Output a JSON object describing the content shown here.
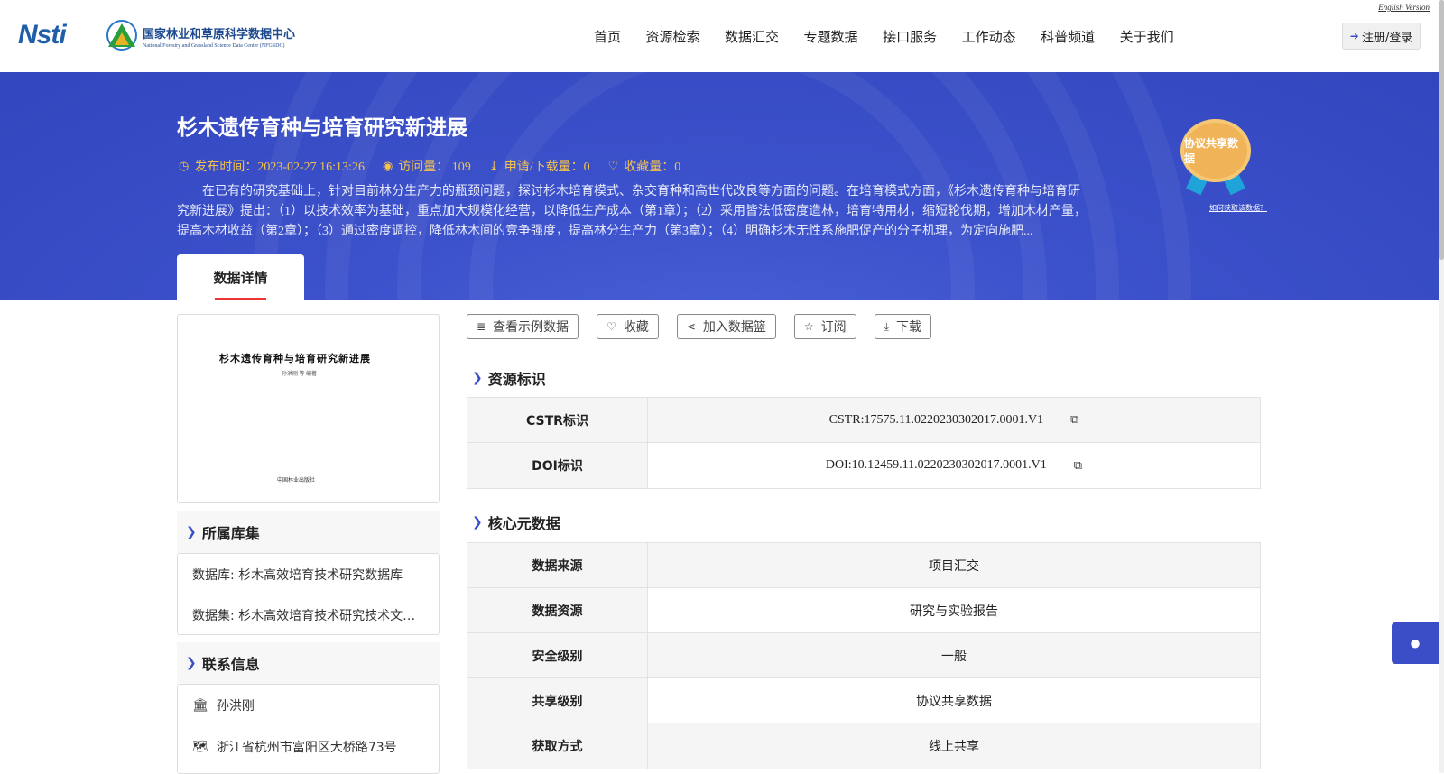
{
  "header": {
    "logo_nsti": "Nsti",
    "logo_cn": "国家林业和草原科学数据中心",
    "logo_en": "National Forestry and Grassland Science Data Center (NFGSDC)",
    "english_version": "English Version",
    "login_label": "注册/登录",
    "nav": [
      "首页",
      "资源检索",
      "数据汇交",
      "专题数据",
      "接口服务",
      "工作动态",
      "科普频道",
      "关于我们"
    ]
  },
  "banner": {
    "title": "杉木遗传育种与培育研究新进展",
    "publish_time": "发布时间：2023-02-27 16:13:26",
    "visits": "访问量： 109",
    "downloads": "申请/下载量：0",
    "favorites": "收藏量：0",
    "description": "在已有的研究基础上，针对目前林分生产力的瓶颈问题，探讨杉木培育模式、杂交育种和高世代改良等方面的问题。在培育模式方面，《杉木遗传育种与培育研究新进展》提出：（1）以技术效率为基础，重点加大规模化经营，以降低生产成本（第1章）；（2）采用皆法低密度造林，培育特用材，缩短轮伐期，增加木材产量，提高木材收益（第2章）；（3）通过密度调控，降低林木间的竞争强度，提高林分生产力（第3章）；（4）明确杉木无性系施肥促产的分子机理，为定向施肥...",
    "badge_text": "协议共享数据",
    "badge_link": "如何获取该数据？",
    "tab_label": "数据详情"
  },
  "cover": {
    "title": "杉木遗传育种与培育研究新进展",
    "authors": "孙洪刚 等 编著",
    "publisher": "中国林业出版社"
  },
  "library": {
    "heading": "所属库集",
    "database": "数据库: 杉木高效培育技术研究数据库",
    "dataset": "数据集: 杉木高效培育技术研究技术文献数据集"
  },
  "contact": {
    "heading": "联系信息",
    "name": "孙洪刚",
    "address": "浙江省杭州市富阳区大桥路73号"
  },
  "actions": {
    "view_sample": "查看示例数据",
    "favorite": "收藏",
    "add_basket": "加入数据篮",
    "subscribe": "订阅",
    "download": "下载"
  },
  "resource_id": {
    "heading": "资源标识",
    "rows": [
      {
        "key": "CSTR标识",
        "value": "CSTR:17575.11.0220230302017.0001.V1"
      },
      {
        "key": "DOI标识",
        "value": "DOI:10.12459.11.0220230302017.0001.V1"
      }
    ]
  },
  "core_meta": {
    "heading": "核心元数据",
    "rows": [
      {
        "key": "数据来源",
        "value": "项目汇交"
      },
      {
        "key": "数据资源",
        "value": "研究与实验报告"
      },
      {
        "key": "安全级别",
        "value": "一般"
      },
      {
        "key": "共享级别",
        "value": "协议共享数据"
      },
      {
        "key": "获取方式",
        "value": "线上共享"
      }
    ]
  },
  "icons": {
    "login": "sign-in-icon",
    "clock": "clock-icon",
    "eye": "eye-icon",
    "download": "download-icon",
    "heart": "heart-icon",
    "database": "database-icon",
    "share": "share-icon",
    "star": "star-icon",
    "bank": "bank-icon",
    "map": "map-icon",
    "copy": "copy-icon",
    "chat": "qq-penguin-icon"
  },
  "colors": {
    "banner": "#3c52cc",
    "accent": "#3b4ec7",
    "meta": "#f5c34b",
    "tab_underline": "#e33333",
    "badge": "#f0b357"
  }
}
